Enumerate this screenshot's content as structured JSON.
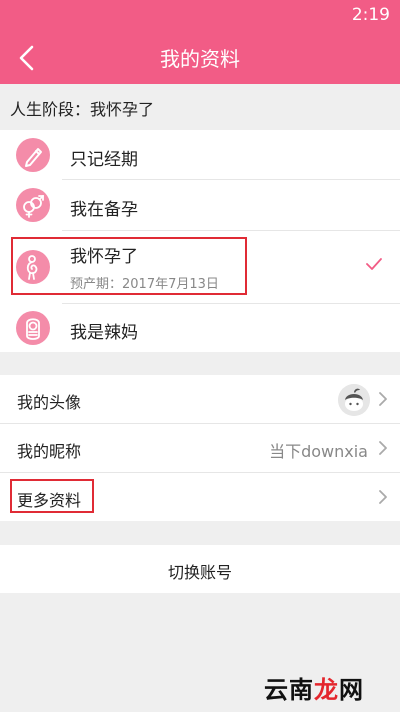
{
  "status_bar": {
    "time": "2:19"
  },
  "app_bar": {
    "title": "我的资料"
  },
  "life_stage": {
    "header": "人生阶段：我怀孕了",
    "items": [
      {
        "label": "只记经期",
        "icon": "pen-icon"
      },
      {
        "label": "我在备孕",
        "icon": "gender-symbols-icon"
      },
      {
        "label": "我怀孕了",
        "icon": "pregnancy-icon",
        "detail": "预产期：2017年7月13日",
        "selected": true
      },
      {
        "label": "我是辣妈",
        "icon": "baby-icon"
      }
    ]
  },
  "profile": {
    "avatar_label": "我的头像",
    "nickname_label": "我的昵称",
    "nickname_value": "当下downxia",
    "more_label": "更多资料"
  },
  "actions": {
    "switch_account": "切换账号"
  },
  "watermark": {
    "text_main": "云南",
    "text_accent": "龙",
    "text_end": "网"
  },
  "colors": {
    "primary": "#f25c86",
    "icon_bg": "#f48ca9",
    "highlight": "#e02b35"
  }
}
